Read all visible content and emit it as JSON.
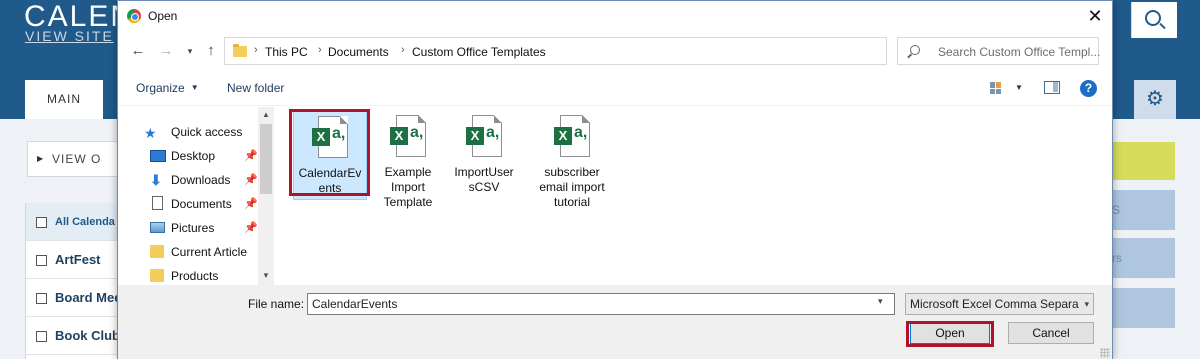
{
  "background": {
    "site_title": "CALEN",
    "view_site": "VIEW SITE",
    "tab_main": "MAIN",
    "view_button": "VIEW O",
    "list": [
      "All Calenda",
      "ArtFest",
      "Board Mee",
      "Book Club"
    ],
    "right_blue_labels": [
      "S",
      "rs",
      ""
    ]
  },
  "dialog": {
    "title": "Open",
    "close": "✕",
    "breadcrumb": [
      "This PC",
      "Documents",
      "Custom Office Templates"
    ],
    "search_placeholder": "Search Custom Office Templ...",
    "toolbar": {
      "organize": "Organize",
      "new_folder": "New folder",
      "help": "?"
    },
    "nav_pane": [
      {
        "label": "Quick access",
        "icon": "star-icon",
        "pinned": false
      },
      {
        "label": "Desktop",
        "icon": "desktop-icon",
        "pinned": true
      },
      {
        "label": "Downloads",
        "icon": "download-icon",
        "pinned": true
      },
      {
        "label": "Documents",
        "icon": "documents-icon",
        "pinned": true
      },
      {
        "label": "Pictures",
        "icon": "pictures-icon",
        "pinned": true
      },
      {
        "label": "Current Article",
        "icon": "folder-icon",
        "pinned": false
      },
      {
        "label": "Products",
        "icon": "folder-icon",
        "pinned": false
      }
    ],
    "files": [
      {
        "name": "CalendarEvents",
        "display": "CalendarEv ents",
        "selected": true
      },
      {
        "name": "Example Import Template",
        "display": "Example Import Template",
        "selected": false
      },
      {
        "name": "ImportUsersCSV",
        "display": "ImportUser sCSV",
        "selected": false
      },
      {
        "name": "subscriber email import tutorial",
        "display": "subscriber email import tutorial",
        "selected": false
      }
    ],
    "file_name_label": "File name:",
    "file_name_value": "CalendarEvents",
    "file_type": "Microsoft Excel Comma Separa",
    "open_button": "Open",
    "cancel_button": "Cancel"
  },
  "colors": {
    "header_blue": "#1f5a8a",
    "highlight_red": "#b01428",
    "selection_blue": "#cce8ff",
    "excel_green": "#1d7044"
  }
}
